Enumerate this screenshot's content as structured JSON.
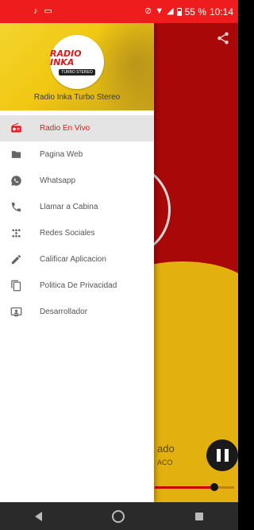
{
  "status_bar": {
    "battery": "55 %",
    "time": "10:14"
  },
  "drawer": {
    "logo_text": "RADIO INKA",
    "logo_subtext": "TURBO STEREO",
    "station_name": "Radio Inka Turbo Stereo",
    "items": [
      {
        "label": "Radio En Vivo",
        "icon": "radio-icon",
        "active": true
      },
      {
        "label": "Pagina Web",
        "icon": "folder-icon",
        "active": false
      },
      {
        "label": "Whatsapp",
        "icon": "whatsapp-icon",
        "active": false
      },
      {
        "label": "Llamar a Cabina",
        "icon": "phone-icon",
        "active": false
      },
      {
        "label": "Redes Sociales",
        "icon": "social-icon",
        "active": false
      },
      {
        "label": "Calificar Aplicacion",
        "icon": "pencil-icon",
        "active": false
      },
      {
        "label": "Politica De Privacidad",
        "icon": "copy-icon",
        "active": false
      },
      {
        "label": "Desarrollador",
        "icon": "developer-icon",
        "active": false
      }
    ]
  },
  "player": {
    "track_title": "ado",
    "track_subtitle": "ACO",
    "progress": 0.75
  },
  "colors": {
    "status_bar": "#ee1c1c",
    "active_item": "#e01b1b",
    "background_red": "#a90808",
    "background_yellow": "#e3b10f"
  }
}
